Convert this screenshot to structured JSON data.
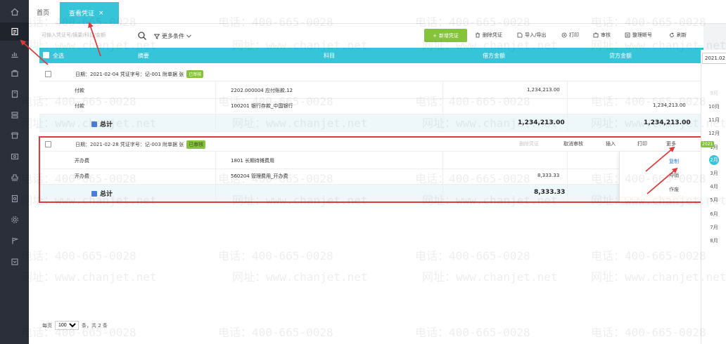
{
  "rail": {
    "icons": [
      "home-icon",
      "voucher-icon",
      "chart-icon",
      "bag-icon",
      "book-icon",
      "stack-icon",
      "shop-icon",
      "card-icon",
      "stamp-icon",
      "doc-icon",
      "gear-icon",
      "flag-icon",
      "box-icon"
    ]
  },
  "tabs": {
    "home": "首页",
    "active": "查看凭证",
    "close": "×"
  },
  "toolbar": {
    "search_placeholder": "可输入凭证号/摘要/科目/金额",
    "more_filter": "更多条件",
    "new_voucher": "新增凭证",
    "delete": "删除凭证",
    "import_export": "导入/导出",
    "print": "打印",
    "audit": "审核",
    "renumber": "整理断号",
    "refresh": "刷新"
  },
  "table": {
    "select_all": "全选",
    "headers": {
      "summary": "摘要",
      "account": "科目",
      "debit": "借方金额",
      "credit": "贷方金额"
    }
  },
  "vouchers": [
    {
      "header": "日期：2021-02-04    凭证字号：记-001    附单据  张",
      "status": "已审核",
      "rows": [
        {
          "summary": "付款",
          "account": "2202.000004  应付账款.12",
          "debit": "1,234,213.00",
          "credit": ""
        },
        {
          "summary": "付款",
          "account": "100201 银行存款_中国银行",
          "debit": "",
          "credit": "1,234,213.00"
        }
      ],
      "total_label": "总计",
      "total_debit": "1,234,213.00",
      "total_credit": "1,234,213.00"
    },
    {
      "header": "日期：2021-02-28    凭证字号：记-003    附单据  张",
      "status": "已审核",
      "actions": {
        "delete": "删除凭证",
        "unaudit": "取消审核",
        "insert": "插入",
        "print": "打印",
        "more": "更多"
      },
      "rows": [
        {
          "summary": "开办费",
          "account": "1801 长期待摊费用",
          "debit": "",
          "credit": ""
        },
        {
          "summary": "开办费",
          "account": "560204 管理费用_开办费",
          "debit": "8,333.33",
          "credit": ""
        }
      ],
      "total_label": "总计",
      "total_debit": "8,333.33",
      "total_credit": ""
    }
  ],
  "more_menu": [
    "复制",
    "冲销",
    "作废"
  ],
  "date_picker": {
    "input": "2021.02",
    "months": [
      "9月",
      "10月",
      "11月",
      "12月",
      "1月",
      "2月",
      "3月",
      "4月",
      "5月",
      "6月",
      "7月",
      "8月"
    ],
    "selected": "2月",
    "year_badge": "2021"
  },
  "pager": {
    "prefix": "每页",
    "size": "100",
    "suffix": "条，共 2 条"
  },
  "watermark": {
    "phone": "电话：400-665-0028",
    "site": "网址：www.chanjet.net"
  },
  "colors": {
    "accent": "#36c5d8",
    "green": "#86c33c",
    "highlight": "#e03b3b"
  }
}
